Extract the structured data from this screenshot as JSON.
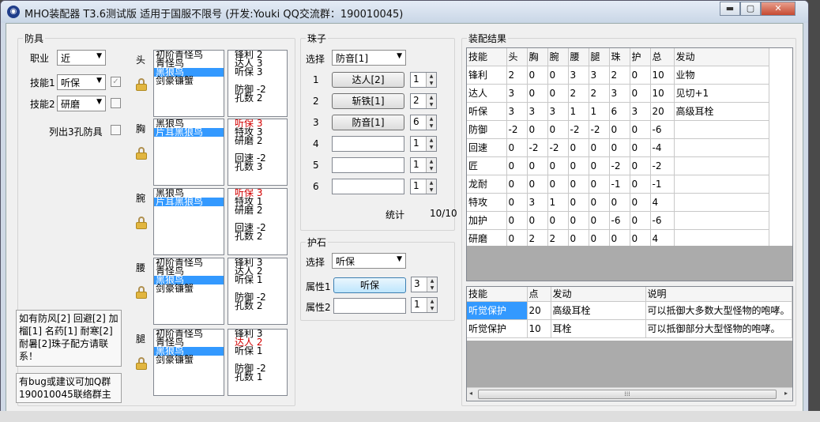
{
  "window": {
    "title": "MHO装配器 T3.6测试版 适用于国服不限号 (开发:Youki QQ交流群：190010045)",
    "controls": {
      "minimize": "▬",
      "maximize": "▢",
      "close": "✕"
    }
  },
  "armor": {
    "group_title": "防具",
    "job_label": "职业",
    "job_value": "近",
    "skill1_label": "技能1",
    "skill1_value": "听保",
    "skill2_label": "技能2",
    "skill2_value": "研磨",
    "list3_label": "列出3孔防具",
    "checkmark": "✓",
    "slots": [
      {
        "label": "头",
        "items": [
          "初阶青怪鸟",
          "青怪鸟",
          "黑狼鸟",
          "剑豪镰蟹"
        ],
        "selected": 2,
        "stats": [
          "锋利 2",
          "达人 3",
          "听保 3",
          "",
          "防御 -2",
          "孔数 2"
        ],
        "red": []
      },
      {
        "label": "胸",
        "items": [
          "黑狼鸟",
          "片耳黑狼鸟"
        ],
        "selected": 1,
        "stats": [
          "听保 3",
          "特攻 3",
          "研磨 2",
          "",
          "回速 -2",
          "孔数 3"
        ],
        "red": [
          0
        ]
      },
      {
        "label": "腕",
        "items": [
          "黑狼鸟",
          "片耳黑狼鸟"
        ],
        "selected": 1,
        "stats": [
          "听保 3",
          "特攻 1",
          "研磨 2",
          "",
          "回速 -2",
          "孔数 2"
        ],
        "red": [
          0
        ]
      },
      {
        "label": "腰",
        "items": [
          "初阶青怪鸟",
          "青怪鸟",
          "黑狼鸟",
          "剑豪镰蟹"
        ],
        "selected": 2,
        "stats": [
          "锋利 3",
          "达人 2",
          "听保 1",
          "",
          "防御 -2",
          "孔数 2"
        ],
        "red": []
      },
      {
        "label": "腿",
        "items": [
          "初阶青怪鸟",
          "青怪鸟",
          "黑狼鸟",
          "剑豪镰蟹"
        ],
        "selected": 2,
        "stats": [
          "锋利 3",
          "达人 2",
          "听保 1",
          "",
          "防御 -2",
          "孔数 1"
        ],
        "red": [
          1
        ]
      }
    ],
    "note1": "如有防风[2] 回避[2] 加榴[1] 名药[1] 耐寒[2] 耐暑[2]珠子配方请联系！",
    "note2": "有bug或建议可加Q群190010045联络群主"
  },
  "jewels": {
    "group_title": "珠子",
    "select_label": "选择",
    "select_value": "防音[1]",
    "rows": [
      {
        "num": "1",
        "name": "达人[2]",
        "count": "1"
      },
      {
        "num": "2",
        "name": "斩铁[1]",
        "count": "2"
      },
      {
        "num": "3",
        "name": "防音[1]",
        "count": "6"
      },
      {
        "num": "4",
        "name": "",
        "count": "1"
      },
      {
        "num": "5",
        "name": "",
        "count": "1"
      },
      {
        "num": "6",
        "name": "",
        "count": "1"
      }
    ],
    "stat_label": "统计",
    "stat_value": "10/10"
  },
  "charm": {
    "group_title": "护石",
    "select_label": "选择",
    "select_value": "听保",
    "attr1_label": "属性1",
    "attr1_value": "听保",
    "attr1_count": "3",
    "attr2_label": "属性2",
    "attr2_value": "",
    "attr2_count": "1"
  },
  "result": {
    "group_title": "装配结果",
    "headers": [
      "技能",
      "头",
      "胸",
      "腕",
      "腰",
      "腿",
      "珠",
      "护",
      "总",
      "发动"
    ],
    "rows": [
      [
        "锋利",
        "2",
        "0",
        "0",
        "3",
        "3",
        "2",
        "0",
        "10",
        "业物"
      ],
      [
        "达人",
        "3",
        "0",
        "0",
        "2",
        "2",
        "3",
        "0",
        "10",
        "见切+1"
      ],
      [
        "听保",
        "3",
        "3",
        "3",
        "1",
        "1",
        "6",
        "3",
        "20",
        "高级耳栓"
      ],
      [
        "防御",
        "-2",
        "0",
        "0",
        "-2",
        "-2",
        "0",
        "0",
        "-6",
        ""
      ],
      [
        "回速",
        "0",
        "-2",
        "-2",
        "0",
        "0",
        "0",
        "0",
        "-4",
        ""
      ],
      [
        "匠",
        "0",
        "0",
        "0",
        "0",
        "0",
        "-2",
        "0",
        "-2",
        ""
      ],
      [
        "龙耐",
        "0",
        "0",
        "0",
        "0",
        "0",
        "-1",
        "0",
        "-1",
        ""
      ],
      [
        "特攻",
        "0",
        "3",
        "1",
        "0",
        "0",
        "0",
        "0",
        "4",
        ""
      ],
      [
        "加护",
        "0",
        "0",
        "0",
        "0",
        "0",
        "-6",
        "0",
        "-6",
        ""
      ],
      [
        "研磨",
        "0",
        "2",
        "2",
        "0",
        "0",
        "0",
        "0",
        "4",
        ""
      ]
    ]
  },
  "detail": {
    "headers": [
      "技能",
      "点",
      "发动",
      "说明"
    ],
    "rows": [
      [
        "听觉保护",
        "20",
        "高级耳栓",
        "可以抵御大多数大型怪物的咆哮。"
      ],
      [
        "听觉保护",
        "10",
        "耳栓",
        "可以抵御部分大型怪物的咆哮。"
      ]
    ],
    "scroll_arrow_left": "◂",
    "scroll_arrow_right": "▸",
    "scroll_grip": "⁞⁞⁞"
  },
  "colors": {
    "selection": "#3399ff",
    "warn": "#d20000"
  }
}
